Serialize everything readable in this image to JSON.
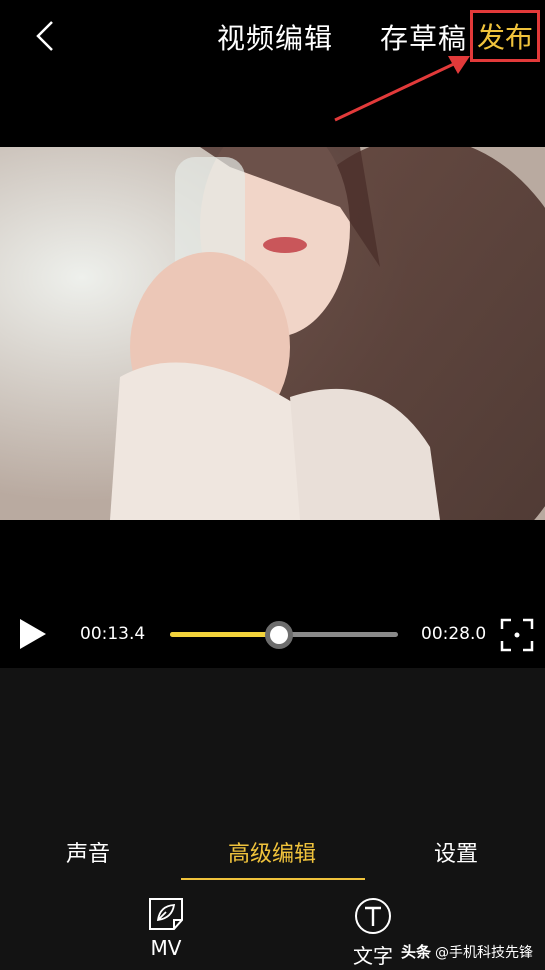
{
  "header": {
    "title": "视频编辑",
    "draft_label": "存草稿",
    "publish_label": "发布"
  },
  "player": {
    "current_time": "00:13.4",
    "total_time": "00:28.0",
    "progress": 0.479
  },
  "tabs": [
    {
      "label": "声音",
      "active": false
    },
    {
      "label": "高级编辑",
      "active": true
    },
    {
      "label": "设置",
      "active": false
    }
  ],
  "tools": [
    {
      "label": "MV",
      "icon": "mv-icon"
    },
    {
      "label": "文字",
      "icon": "text-icon"
    }
  ],
  "watermark": {
    "brand": "头条",
    "handle": "@手机科技先锋"
  },
  "colors": {
    "accent": "#f0c33c",
    "highlight_box": "#e23a3a",
    "progress_fill": "#f3d33b"
  }
}
